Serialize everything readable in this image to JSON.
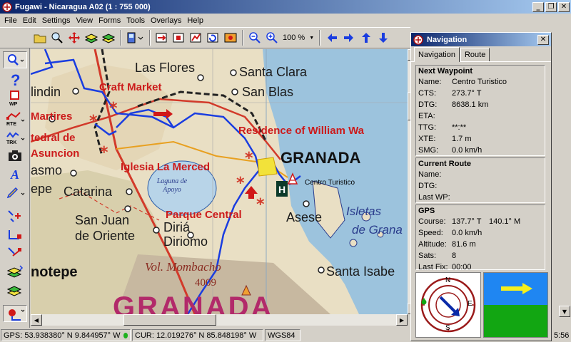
{
  "window": {
    "title": "Fugawi - Nicaragua A02  (1 : 755 000)"
  },
  "menu": [
    "File",
    "Edit",
    "Settings",
    "View",
    "Forms",
    "Tools",
    "Overlays",
    "Help"
  ],
  "toolbar": {
    "zoom_value": "100 %"
  },
  "map": {
    "labels": {
      "las_flores": "Las Flores",
      "santa_clara": "Santa Clara",
      "san_blas": "San Blas",
      "craft_market": "Craft Market",
      "lindin": "lindin",
      "martires": "Martires",
      "catedral_de": "tedral de",
      "asuncion": "Asuncion",
      "residence": "Residence of William Wa",
      "granada_city": "GRANADA",
      "masmo": "asmo",
      "iglesia": "Iglesia La Merced",
      "laguna": "Laguna de Apoyo",
      "catarina": "Catarina",
      "epe": "epe",
      "parque": "Parque Central",
      "asese": "Asese",
      "isletas_1": "Isletas",
      "isletas_2": "de Grana",
      "san_juan_1": "San Juan",
      "san_juan_2": "de Oriente",
      "diria": "Diriá",
      "diriomo": "Diriomo",
      "notepe": "notepe",
      "vol_mombacho": "Vol. Mombacho",
      "elevation": "4009",
      "santa_isabel": "Santa Isabe",
      "granada_region": "GRANADA",
      "waypoint": "Centro Turistico"
    }
  },
  "navigation": {
    "title": "Navigation",
    "tabs": [
      "Navigation",
      "Route"
    ],
    "next_waypoint": {
      "title": "Next Waypoint",
      "rows": [
        {
          "k": "Name:",
          "v": "Centro Turistico"
        },
        {
          "k": "CTS:",
          "v": "273.7° T"
        },
        {
          "k": "DTG:",
          "v": "8638.1 km"
        },
        {
          "k": "ETA:",
          "v": ""
        },
        {
          "k": "TTG:",
          "v": "**:**"
        },
        {
          "k": "XTE:",
          "v": "1.7 m"
        },
        {
          "k": "SMG:",
          "v": "0.0 km/h"
        }
      ]
    },
    "current_route": {
      "title": "Current Route",
      "rows": [
        {
          "k": "Name:",
          "v": ""
        },
        {
          "k": "DTG:",
          "v": ""
        },
        {
          "k": "Last WP:",
          "v": ""
        }
      ]
    },
    "gps": {
      "title": "GPS",
      "course_true": "137.7° T",
      "course_mag": "140.1° M",
      "rows": [
        {
          "k": "Speed:",
          "v": "0.0 km/h"
        },
        {
          "k": "Altitude:",
          "v": "81.6 m"
        },
        {
          "k": "Sats:",
          "v": "8"
        },
        {
          "k": "Last Fix:",
          "v": "00:00"
        }
      ],
      "course_label": "Course:"
    },
    "compass": {
      "n": "N",
      "e": "E",
      "s": "S"
    }
  },
  "status": {
    "gps": "GPS: 53.938380° N 9.844957° W",
    "cur": "CUR: 12.019276° N 85.848198° W",
    "datum": "WGS84",
    "time": "5:56"
  },
  "colors": {
    "route_blue": "#1a3de0",
    "road_red": "#d23a2a",
    "title_blue": "#0a246a"
  }
}
